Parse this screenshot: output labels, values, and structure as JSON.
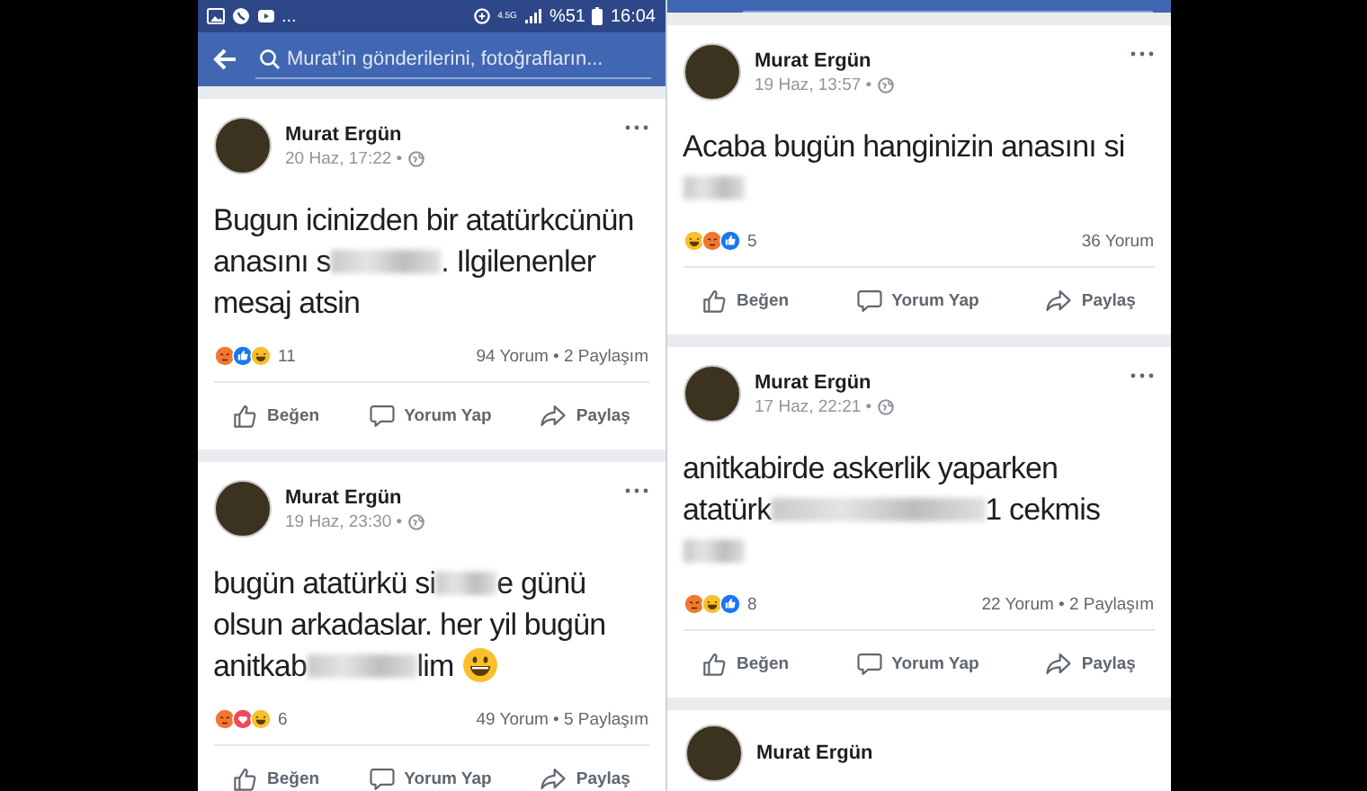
{
  "left_screen": {
    "status_bar": {
      "more": "...",
      "network": "4.5G",
      "battery": "%51",
      "time": "16:04"
    },
    "search": {
      "placeholder": "Murat'in gönderilerini, fotoğrafların..."
    },
    "posts": [
      {
        "kind": "full",
        "author": "Murat Ergün",
        "time": "20 Haz, 17:22 •",
        "body": [
          {
            "kind": "text",
            "text": "Bugun icinizden bir atatürkcünün anasını s"
          },
          {
            "kind": "blur-long"
          },
          {
            "kind": "text",
            "text": ". Ilgilenenler mesaj atsin"
          }
        ],
        "reactions": [
          {
            "kind": "angry"
          },
          {
            "kind": "like"
          },
          {
            "kind": "haha"
          }
        ],
        "reaction_count": "11",
        "stats": "94 Yorum • 2 Paylaşım",
        "actions": [
          {
            "kind": "like",
            "label": "Beğen"
          },
          {
            "kind": "comment",
            "label": "Yorum Yap"
          },
          {
            "kind": "share",
            "label": "Paylaş"
          }
        ]
      },
      {
        "kind": "full",
        "author": "Murat Ergün",
        "time": "19 Haz, 23:30 •",
        "body": [
          {
            "kind": "text",
            "text": "bugün atatürkü si"
          },
          {
            "kind": "blur-short"
          },
          {
            "kind": "text",
            "text": "e günü olsun arkadaslar. her yil bugün anitkab"
          },
          {
            "kind": "blur-long"
          },
          {
            "kind": "text",
            "text": "lim "
          },
          {
            "kind": "emoji"
          }
        ],
        "reactions": [
          {
            "kind": "angry"
          },
          {
            "kind": "love"
          },
          {
            "kind": "haha"
          }
        ],
        "reaction_count": "6",
        "stats": "49 Yorum • 5 Paylaşım",
        "actions": [
          {
            "kind": "like",
            "label": "Beğen"
          },
          {
            "kind": "comment",
            "label": "Yorum Yap"
          },
          {
            "kind": "share",
            "label": "Paylaş"
          }
        ]
      }
    ]
  },
  "right_screen": {
    "posts": [
      {
        "kind": "full",
        "author": "Murat Ergün",
        "time": "19 Haz, 13:57 •",
        "body": [
          {
            "kind": "text",
            "text": "Acaba bugün hanginizin anasını si"
          },
          {
            "kind": "blur-short"
          }
        ],
        "reactions": [
          {
            "kind": "haha"
          },
          {
            "kind": "angry"
          },
          {
            "kind": "like"
          }
        ],
        "reaction_count": "5",
        "stats": "36 Yorum",
        "actions": [
          {
            "kind": "like",
            "label": "Beğen"
          },
          {
            "kind": "comment",
            "label": "Yorum Yap"
          },
          {
            "kind": "share",
            "label": "Paylaş"
          }
        ]
      },
      {
        "kind": "full",
        "author": "Murat Ergün",
        "time": "17 Haz, 22:21 •",
        "body": [
          {
            "kind": "text",
            "text": "anitkabirde askerlik yaparken atatürk"
          },
          {
            "kind": "blur-xlong"
          },
          {
            "kind": "text",
            "text": "1 cekmis"
          },
          {
            "kind": "blur-short"
          }
        ],
        "reactions": [
          {
            "kind": "angry"
          },
          {
            "kind": "haha"
          },
          {
            "kind": "like"
          }
        ],
        "reaction_count": "8",
        "stats": "22 Yorum • 2 Paylaşım",
        "actions": [
          {
            "kind": "like",
            "label": "Beğen"
          },
          {
            "kind": "comment",
            "label": "Yorum Yap"
          },
          {
            "kind": "share",
            "label": "Paylaş"
          }
        ]
      },
      {
        "kind": "cut",
        "author": "Murat Ergün"
      }
    ]
  }
}
